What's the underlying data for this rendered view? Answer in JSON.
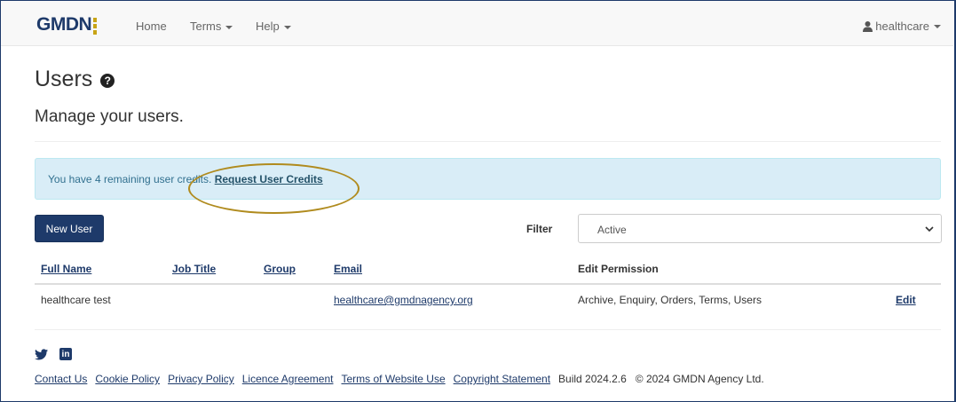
{
  "navbar": {
    "logo_text": "GMDN",
    "links": [
      "Home",
      "Terms",
      "Help"
    ],
    "user": "healthcare"
  },
  "header": {
    "title": "Users",
    "subtitle": "Manage your users."
  },
  "alert": {
    "text": "You have 4 remaining user credits.",
    "link": "Request User Credits"
  },
  "controls": {
    "new_user_label": "New User",
    "filter_label": "Filter",
    "filter_value": "Active"
  },
  "table": {
    "columns": [
      "Full Name",
      "Job Title",
      "Group",
      "Email",
      "Edit Permission"
    ],
    "rows": [
      {
        "full_name": "healthcare test",
        "job_title": "",
        "group": "",
        "email": "healthcare@gmdnagency.org",
        "permission": "Archive, Enquiry, Orders, Terms, Users",
        "action": "Edit"
      }
    ]
  },
  "footer": {
    "social_icons": [
      "twitter-icon",
      "linkedin-icon"
    ],
    "links": [
      "Contact Us",
      "Cookie Policy",
      "Privacy Policy",
      "Licence Agreement",
      "Terms of Website Use",
      "Copyright Statement"
    ],
    "build": "Build 2024.2.6",
    "copyright": "© 2024 GMDN Agency Ltd."
  },
  "colors": {
    "brand_navy": "#1e3a6a",
    "brand_gold": "#c8a415",
    "alert_bg": "#d9edf7",
    "highlight_oval": "#b08b1e"
  }
}
